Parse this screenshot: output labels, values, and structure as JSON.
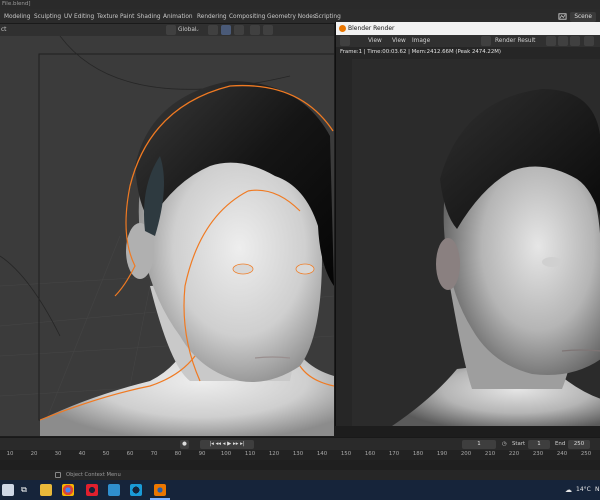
{
  "window": {
    "title_fragment": "File.blend]"
  },
  "workspace_tabs": [
    "Modeling",
    "Sculpting",
    "UV Editing",
    "Texture Paint",
    "Shading",
    "Animation",
    "Rendering",
    "Compositing",
    "Geometry Nodes",
    "Scripting"
  ],
  "workspace_right": {
    "scene_label": "Scene"
  },
  "viewport_header": {
    "mode_fragment": "ct",
    "orientation": "Global"
  },
  "render_window": {
    "title": "Blender Render",
    "menu": {
      "view": "View",
      "view2": "View",
      "image": "Image"
    },
    "slot": "Render Result",
    "info": "Frame:1 | Time:00:03.62 | Mem:2412.66M (Peak 2474.22M)"
  },
  "timeline": {
    "current_frame": "1",
    "start_label": "Start",
    "start": "1",
    "end_label": "End",
    "end": "250",
    "ruler": [
      "10",
      "20",
      "30",
      "40",
      "50",
      "60",
      "70",
      "80",
      "90",
      "100",
      "110",
      "120",
      "130",
      "140",
      "150",
      "160",
      "170",
      "180",
      "190",
      "200",
      "210",
      "220",
      "230",
      "240",
      "250"
    ]
  },
  "status_bar": {
    "hint": "Object Context Menu"
  },
  "taskbar": {
    "temperature": "14°C",
    "tray_letter": "N"
  },
  "colors": {
    "selection_outline": "#f07a22",
    "blender_orange": "#ea7600",
    "taskbar_bg": "#16243a"
  }
}
